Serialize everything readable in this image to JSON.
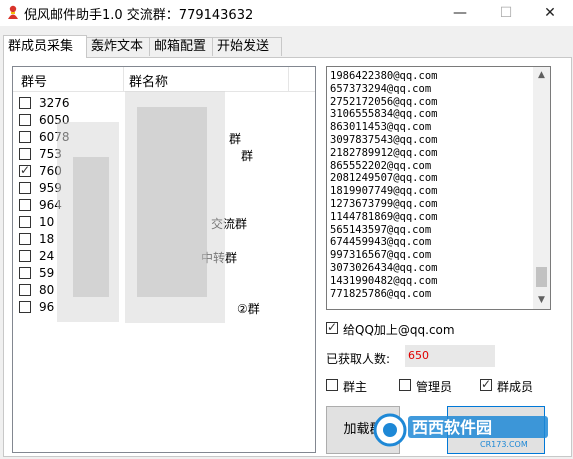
{
  "window": {
    "title": "倪风邮件助手1.0 交流群：779143632",
    "minimize_glyph": "—",
    "maximize_glyph": "☐",
    "close_glyph": "✕"
  },
  "tabs": [
    {
      "label": "群成员采集",
      "active": true
    },
    {
      "label": "轰炸文本",
      "active": false
    },
    {
      "label": "邮箱配置",
      "active": false
    },
    {
      "label": "开始发送",
      "active": false
    }
  ],
  "group_list": {
    "columns": [
      "群号",
      "群名称"
    ],
    "rows": [
      {
        "id": "3276",
        "name": "",
        "checked": false
      },
      {
        "id": "6050",
        "name": "",
        "checked": false
      },
      {
        "id": "6078",
        "name": "群",
        "checked": false
      },
      {
        "id": "753",
        "name": "群",
        "checked": false
      },
      {
        "id": "760",
        "name": "",
        "checked": true
      },
      {
        "id": "959",
        "name": "",
        "checked": false
      },
      {
        "id": "964",
        "name": "",
        "checked": false
      },
      {
        "id": "10",
        "name": "交流群",
        "checked": false
      },
      {
        "id": "18",
        "name": "",
        "checked": false
      },
      {
        "id": "24",
        "name": "中转群",
        "checked": false
      },
      {
        "id": "59",
        "name": "",
        "checked": false
      },
      {
        "id": "80",
        "name": "",
        "checked": false
      },
      {
        "id": "96",
        "name": "②群",
        "checked": false
      }
    ]
  },
  "emails": [
    "1986422380@qq.com",
    "657373294@qq.com",
    "2752172056@qq.com",
    "3106555834@qq.com",
    "863011453@qq.com",
    "3097837543@qq.com",
    "2182789912@qq.com",
    "865552202@qq.com",
    "2081249507@qq.com",
    "1819907749@qq.com",
    "1273673799@qq.com",
    "1144781869@qq.com",
    "565143597@qq.com",
    "674459943@qq.com",
    "997316567@qq.com",
    "3073026434@qq.com",
    "1431990482@qq.com",
    "771825786@qq.com"
  ],
  "options": {
    "add_qq_suffix": {
      "label": "给QQ加上@qq.com",
      "checked": true
    },
    "count_label": "已获取人数:",
    "count_value": "650",
    "role_owner": {
      "label": "群主",
      "checked": false
    },
    "role_admin": {
      "label": "管理员",
      "checked": false
    },
    "role_member": {
      "label": "群成员",
      "checked": true
    }
  },
  "buttons": {
    "load_groups": "加载群"
  },
  "watermark": {
    "text": "西西软件园",
    "url_text": "CR173.COM"
  },
  "colors": {
    "accent": "#0078d7",
    "count": "#e00000",
    "watermark": "#1e88d6"
  }
}
